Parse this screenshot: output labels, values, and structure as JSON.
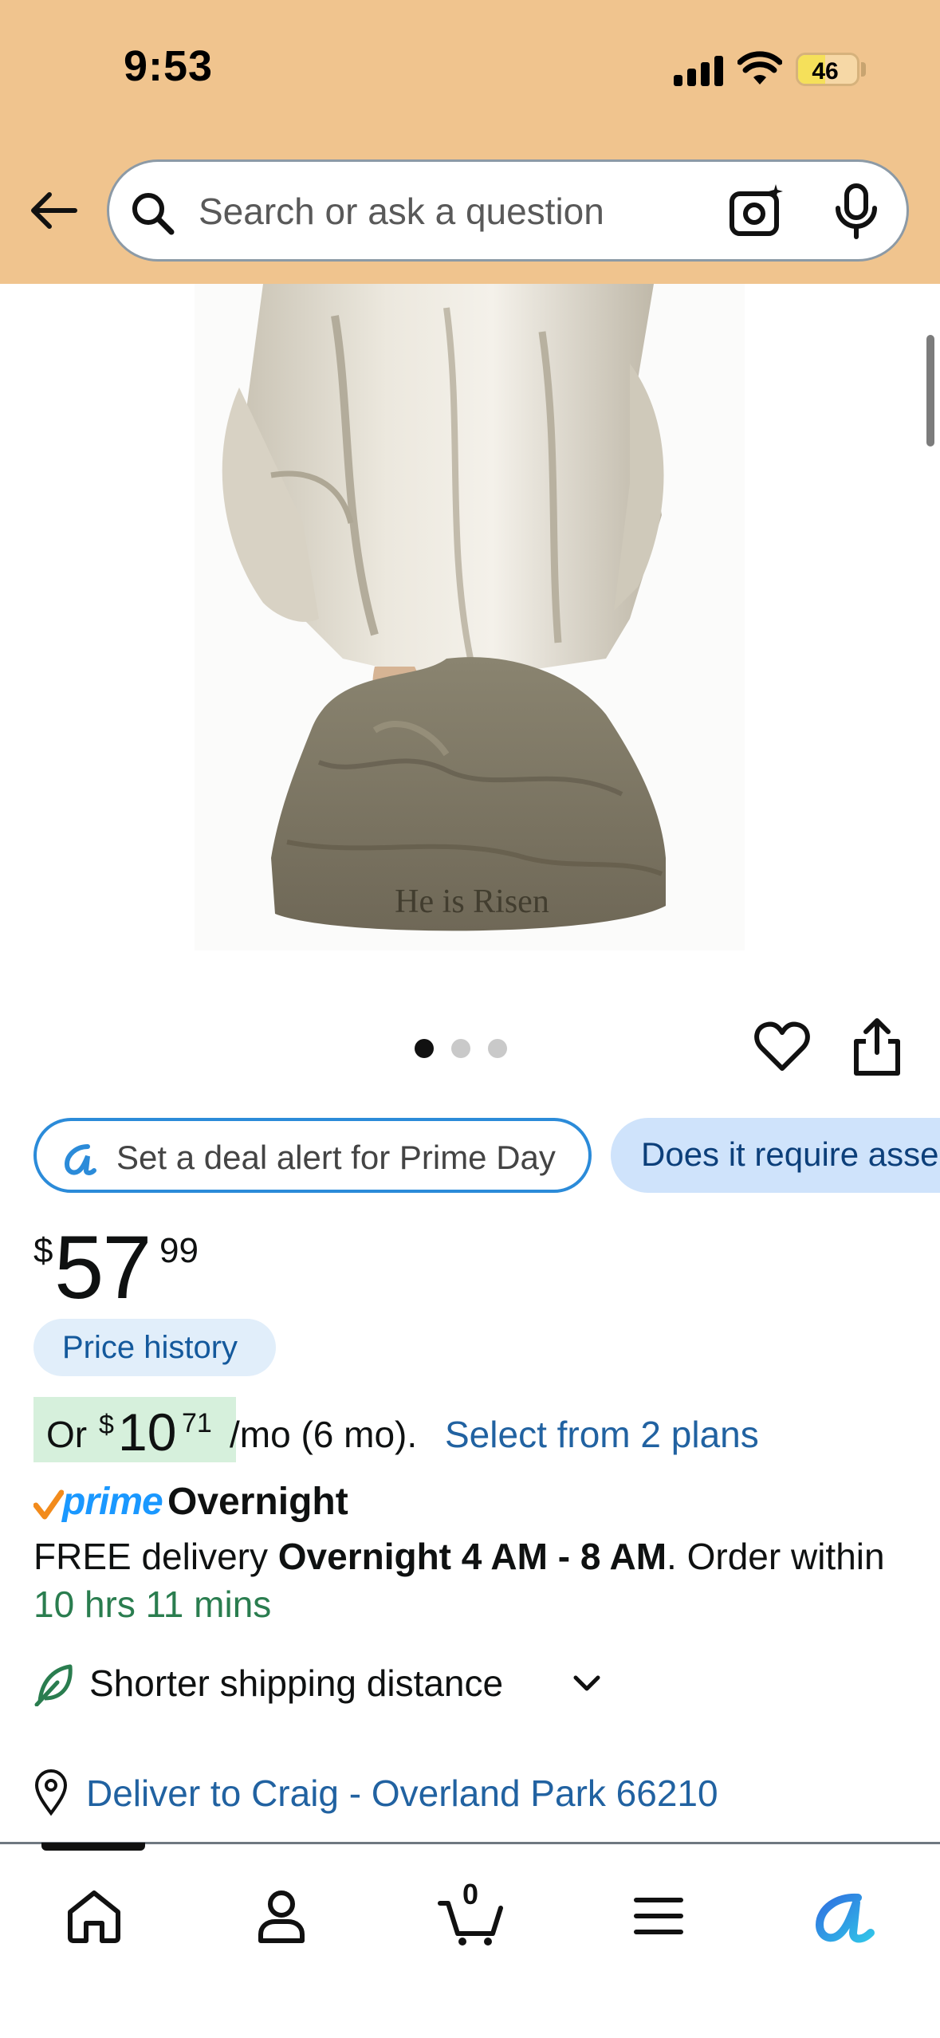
{
  "status_bar": {
    "time": "9:53",
    "battery": "46"
  },
  "search": {
    "placeholder": "Search or ask a question"
  },
  "product_image": {
    "engraving": "He is Risen",
    "alt": "He is Risen"
  },
  "carousel": {
    "total_dots": 3,
    "active_index": 0
  },
  "chips": {
    "deal_alert": "Set a deal alert for Prime Day",
    "question": "Does it require assembly?"
  },
  "price": {
    "symbol": "$",
    "whole": "57",
    "fraction": "99"
  },
  "price_history_label": "Price history",
  "installment": {
    "or": "Or",
    "dollar": "$",
    "whole": "10",
    "fraction": "71",
    "rest": "/mo (6 mo).",
    "link": "Select from 2 plans"
  },
  "prime": {
    "word": "prime",
    "speed": "Overnight"
  },
  "delivery": {
    "prefix": "FREE delivery ",
    "window": "Overnight 4 AM - 8 AM",
    "middle": ". Order within ",
    "countdown": "10 hrs 11 mins"
  },
  "shipping_note": "Shorter shipping distance",
  "deliver_to": "Deliver to Craig - Overland Park 66210",
  "bottom_nav": {
    "cart_count": "0"
  },
  "colors": {
    "header_bg": "#f0c48e",
    "link_blue": "#2162a1",
    "prime_blue": "#1a98ff",
    "countdown_green": "#2a7d4f",
    "installment_bg": "#d6f0dc"
  }
}
